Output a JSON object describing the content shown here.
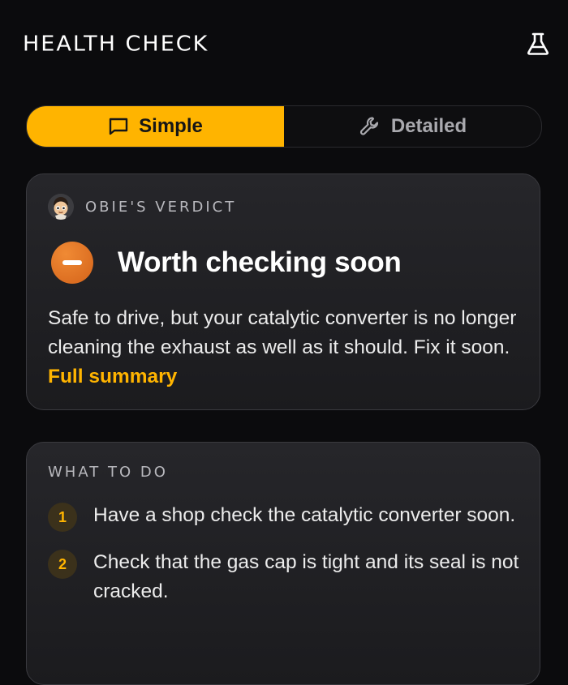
{
  "header": {
    "title": "HEALTH CHECK",
    "action_icon": "flask-icon"
  },
  "view_toggle": {
    "options": [
      {
        "label": "Simple",
        "icon": "chat-bubble-icon",
        "selected": true
      },
      {
        "label": "Detailed",
        "icon": "wrench-icon",
        "selected": false
      }
    ],
    "active_color": "#ffb400"
  },
  "verdict": {
    "eyebrow": "OBIE'S VERDICT",
    "status_icon": "minus-circle-icon",
    "status_color": "#e07020",
    "title": "Worth checking soon",
    "body": "Safe to drive, but your catalytic converter is no longer cleaning the exhaust as well as it should. Fix it soon.",
    "link": "Full summary"
  },
  "todo": {
    "title": "WHAT TO DO",
    "steps": [
      {
        "num": "1",
        "text": "Have a shop check the catalytic converter soon."
      },
      {
        "num": "2",
        "text": "Check that the gas cap is tight and its seal is not cracked."
      }
    ]
  }
}
